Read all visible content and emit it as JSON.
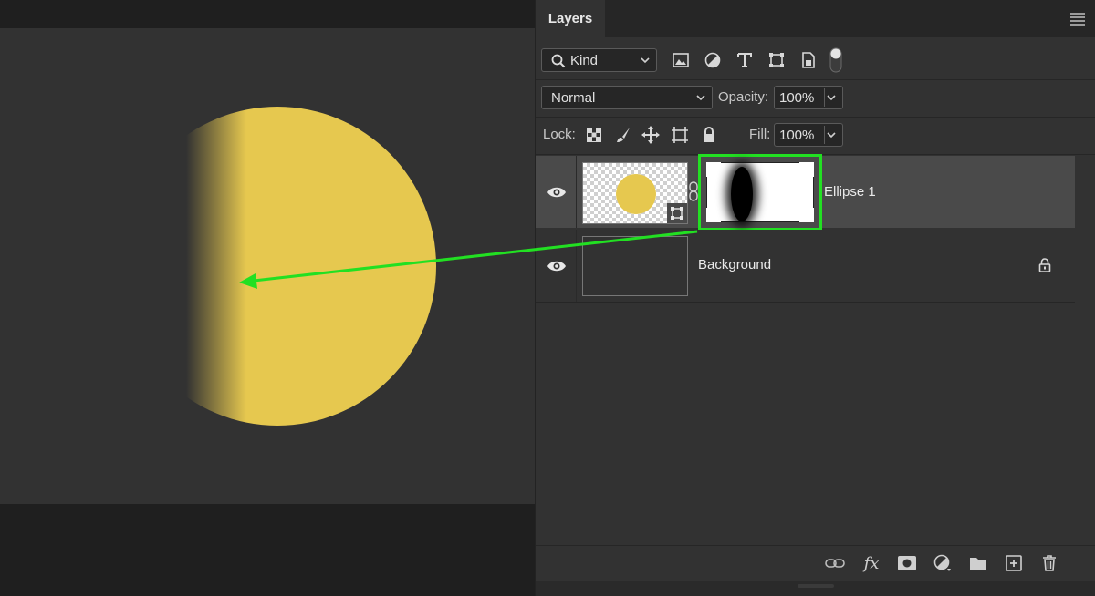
{
  "panel": {
    "tab_title": "Layers",
    "menu_icon": "panel-menu-icon"
  },
  "filter": {
    "kind_label": "Kind",
    "icons": [
      "image-filter-icon",
      "adjustment-filter-icon",
      "type-filter-icon",
      "shape-filter-icon",
      "smart-object-filter-icon",
      "filter-toggle-icon"
    ]
  },
  "blend": {
    "mode_value": "Normal",
    "opacity_label": "Opacity:",
    "opacity_value": "100%"
  },
  "lock": {
    "label": "Lock:",
    "icons": [
      "lock-transparent-pixels-icon",
      "lock-image-pixels-icon",
      "lock-position-icon",
      "lock-artboard-icon",
      "lock-all-icon"
    ],
    "fill_label": "Fill:",
    "fill_value": "100%"
  },
  "layers": [
    {
      "name": "Ellipse 1",
      "visible": true,
      "selected": true,
      "has_mask": true
    },
    {
      "name": "Background",
      "visible": true,
      "locked": true
    }
  ],
  "bottom_toolbar": [
    "link-layers-icon",
    "fx-icon",
    "add-mask-icon",
    "adjustment-layer-icon",
    "new-group-icon",
    "new-layer-icon",
    "delete-layer-icon"
  ],
  "fx_label": "fx",
  "colors": {
    "ellipse_fill": "#e6c84f",
    "highlight": "#22e022",
    "panel_bg": "#323232",
    "selected_row": "#4a4a4a"
  }
}
